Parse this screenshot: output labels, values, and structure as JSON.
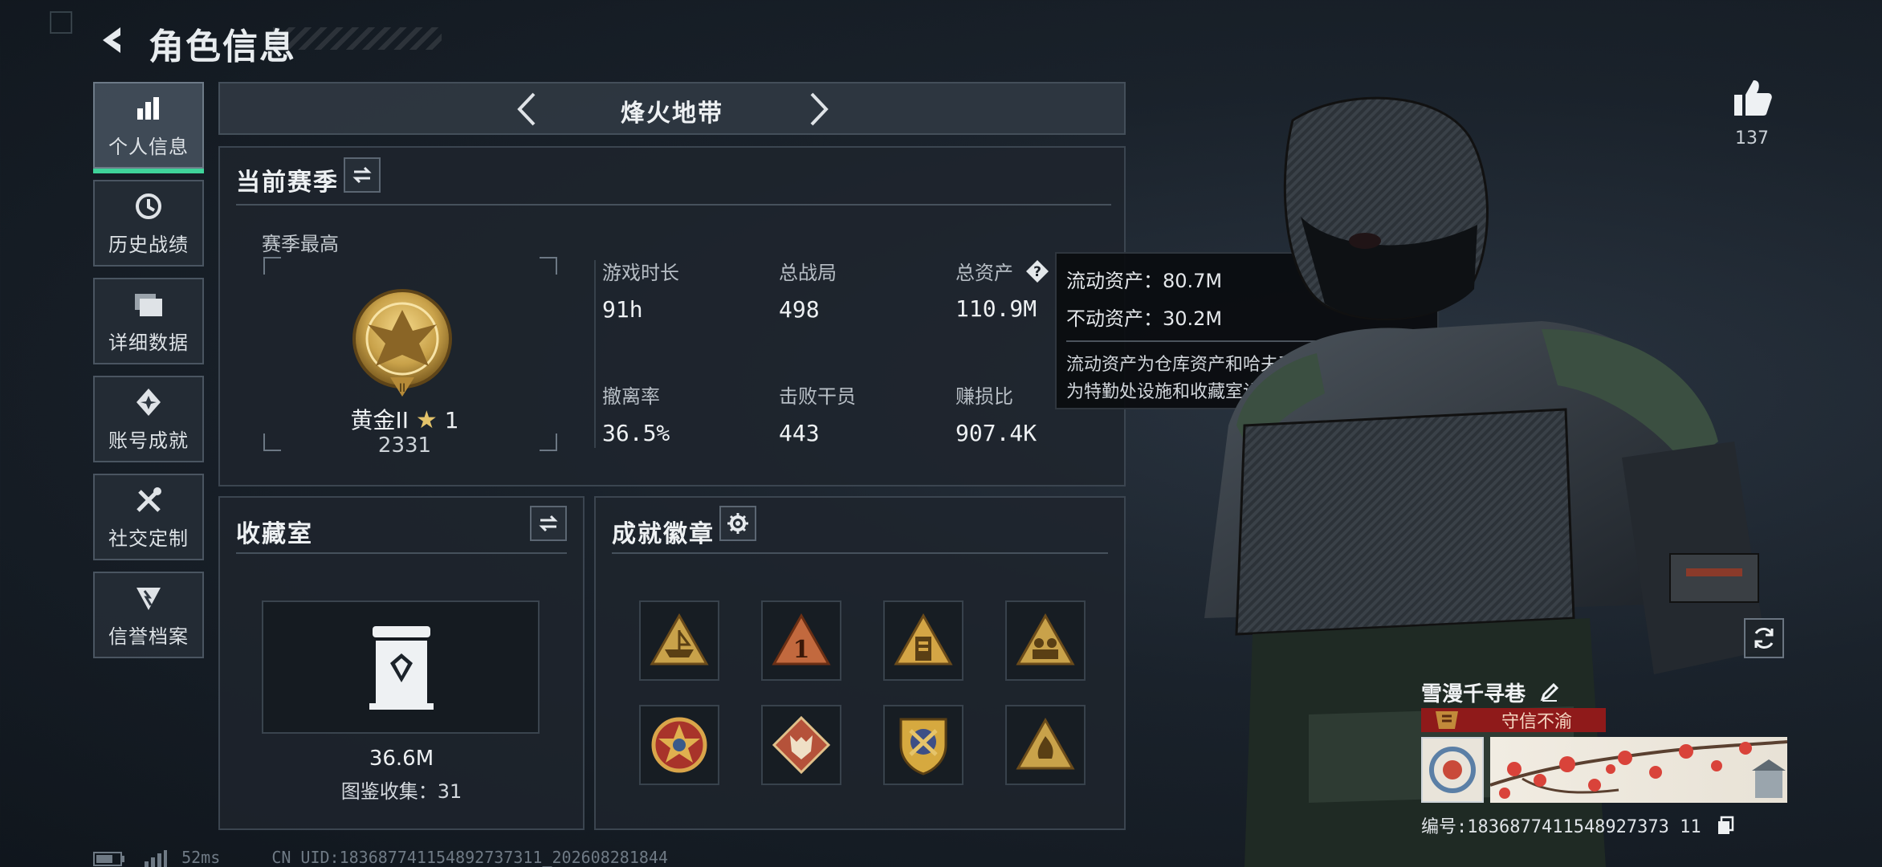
{
  "header": {
    "title": "角色信息"
  },
  "sidebar": {
    "items": [
      {
        "label": "个人信息",
        "icon": "bar-chart-icon",
        "active": true
      },
      {
        "label": "历史战绩",
        "icon": "history-icon"
      },
      {
        "label": "详细数据",
        "icon": "folder-icon"
      },
      {
        "label": "账号成就",
        "icon": "achievement-icon"
      },
      {
        "label": "社交定制",
        "icon": "tools-icon"
      },
      {
        "label": "信誉档案",
        "icon": "credit-icon"
      }
    ]
  },
  "mode": {
    "title": "烽火地带"
  },
  "season": {
    "title": "当前赛季",
    "best_label": "赛季最高",
    "rank_name": "黄金II",
    "rank_stars": "1",
    "rank_score": "2331",
    "stats": [
      {
        "label": "游戏时长",
        "value": "91h"
      },
      {
        "label": "总战局",
        "value": "498"
      },
      {
        "label": "总资产",
        "value": "110.9M"
      },
      {
        "label": "撤离率",
        "value": "36.5%"
      },
      {
        "label": "击败干员",
        "value": "443"
      },
      {
        "label": "赚损比",
        "value": "907.4K"
      }
    ]
  },
  "tooltip": {
    "liquid": "流动资产：80.7M",
    "fixed": "不动资产：30.2M",
    "desc_line1": "流动资产为仓库资产和哈夫币，不动资产",
    "desc_line2": "为特勤处设施和收藏室设施"
  },
  "collection": {
    "title": "收藏室",
    "value": "36.6M",
    "catalog": "图鉴收集：31"
  },
  "badges": {
    "title": "成就徽章",
    "items": [
      "boat-badge-icon",
      "number-one-badge-icon",
      "tower-badge-icon",
      "squad-badge-icon",
      "star-emblem-badge-icon",
      "wolf-badge-icon",
      "shield-badge-icon",
      "fire-badge-icon"
    ]
  },
  "likes": {
    "count": "137"
  },
  "player": {
    "name": "雪漫千寻巷",
    "title": "守信不渝",
    "id_text": "编号:1836877411548927373 11"
  },
  "footer": {
    "ping": "52ms",
    "uid": "CN UID:183687741154892737311_202608281844"
  },
  "colors": {
    "accent_green": "#3fd39a",
    "title_red": "#8f1a1a",
    "gold": "#c9a24a"
  }
}
